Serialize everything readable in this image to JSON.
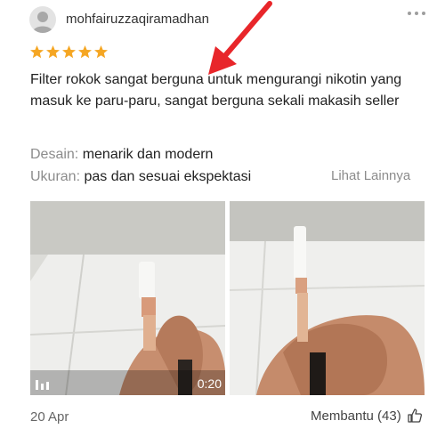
{
  "review": {
    "username": "mohfairuzzaqiramadhan",
    "rating": 5,
    "text": "Filter rokok sangat berguna untuk mengurangi nikotin yang masuk ke paru-paru, sangat berguna sekali makasih seller",
    "attributes": [
      {
        "key": "Desain:",
        "value": "menarik dan modern"
      },
      {
        "key": "Ukuran:",
        "value": "pas dan sesuai ekspektasi"
      }
    ],
    "see_more": "Lihat Lainnya",
    "video_duration": "0:20",
    "date": "20 Apr",
    "helpful_label": "Membantu (43)"
  },
  "colors": {
    "star": "#f5a623",
    "arrow": "#e8262a"
  },
  "icons": [
    "avatar",
    "more-options-icon",
    "star-icon",
    "video-icon",
    "thumbs-up-icon",
    "red-arrow-annotation"
  ]
}
